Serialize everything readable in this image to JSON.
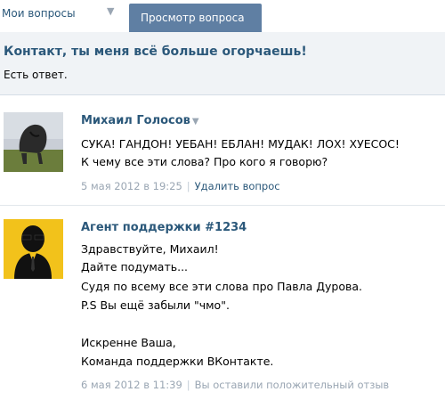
{
  "tabs": {
    "my_questions": "Мои вопросы",
    "view_question": "Просмотр вопроса"
  },
  "question": {
    "title": "Контакт, ты меня всё больше огорчаешь!",
    "status": "Есть ответ."
  },
  "messages": [
    {
      "author": "Михаил Голосов",
      "lines": [
        "СУКА! ГАНДОН! УЕБАН! ЕБЛАН! МУДАК! ЛОХ! ХУЕСОС!",
        "К чему все эти слова? Про кого я говорю?"
      ],
      "date": "5 мая 2012 в 19:25",
      "action": "Удалить вопрос"
    },
    {
      "author": "Агент поддержки #1234",
      "lines": [
        "Здравствуйте, Михаил!",
        "Дайте подумать...",
        "Судя по всему все эти слова про Павла Дурова.",
        "P.S Вы ещё забыли \"чмо\".",
        "",
        "Искренне Ваша,",
        "Команда поддержки ВКонтакте."
      ],
      "date": "6 мая 2012 в 11:39",
      "action": "Вы оставили положительный отзыв"
    }
  ],
  "colors": {
    "link": "#2b587a",
    "tab_active_bg": "#5f7fa3",
    "header_bg": "#f0f3f6",
    "meta": "#9aa6b3"
  }
}
